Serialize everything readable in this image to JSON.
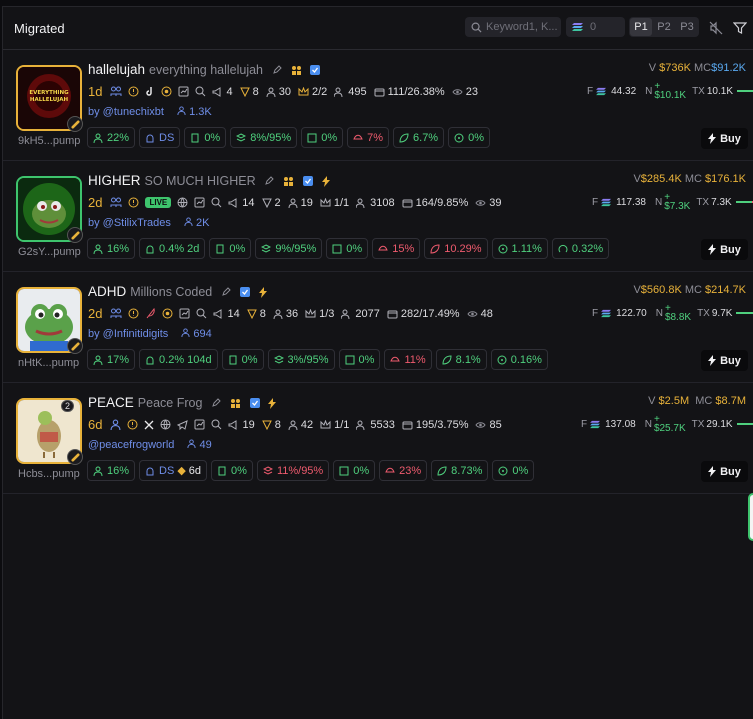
{
  "header": {
    "title": "Migrated",
    "search_placeholder": "Keyword1, K...",
    "min_value": "0",
    "pages": [
      "P1",
      "P2",
      "P3"
    ],
    "active_page": "P1"
  },
  "tokens": [
    {
      "symbol": "hallelujah",
      "name": "everything hallelujah",
      "age": "1d",
      "holders": "4",
      "top10": "8",
      "snipers": "30",
      "dev_holdings": "2/2",
      "holders_count": "495",
      "bundle": "111/26.38%",
      "views": "23",
      "by": "by @tunechixbt",
      "followers": "1.3K",
      "address": "9kH5...pump",
      "volume": "$736K",
      "market_cap": "$91.2K",
      "f_value": "44.32",
      "n_value": "$10.1K",
      "tx": "10.1K",
      "tx_ratio": 0.8,
      "chips": [
        "22%",
        "DS",
        "0%",
        "8%/95%",
        "0%",
        "7%",
        "6.7%",
        "0%"
      ],
      "buy_label": "Buy",
      "avatar_caption": "EVERYTHING HALLELUJAH"
    },
    {
      "symbol": "HIGHER",
      "name": "SO MUCH HIGHER",
      "age": "2d",
      "live_label": "LIVE",
      "holders": "14",
      "top10": "2",
      "snipers": "19",
      "dev_holdings": "1/1",
      "holders_count": "3108",
      "bundle": "164/9.85%",
      "views": "39",
      "by": "by @StilixTrades",
      "followers": "2K",
      "address": "G2sY...pump",
      "volume": "$285.4K",
      "market_cap": "$176.1K",
      "f_value": "117.38",
      "n_value": "$7.3K",
      "tx": "7.3K",
      "tx_ratio": 0.75,
      "chips": [
        "16%",
        "0.4% 2d",
        "0%",
        "9%/95%",
        "0%",
        "15%",
        "10.29%",
        "1.11%",
        "0.32%"
      ],
      "buy_label": "Buy"
    },
    {
      "symbol": "ADHD",
      "name": "Millions Coded",
      "age": "2d",
      "holders": "14",
      "top10": "8",
      "snipers": "36",
      "dev_holdings": "1/3",
      "holders_count": "2077",
      "bundle": "282/17.49%",
      "views": "48",
      "by": "by @Infinitidigits",
      "followers": "694",
      "address": "nHtK...pump",
      "volume": "$560.8K",
      "market_cap": "$214.7K",
      "f_value": "122.70",
      "n_value": "$8.8K",
      "tx": "9.7K",
      "tx_ratio": 0.8,
      "chips": [
        "17%",
        "0.2% 104d",
        "0%",
        "3%/95%",
        "0%",
        "11%",
        "8.1%",
        "0.16%"
      ],
      "buy_label": "Buy"
    },
    {
      "symbol": "PEACE",
      "name": "Peace Frog",
      "age": "6d",
      "avatar_count": "2",
      "holders": "19",
      "top10": "8",
      "snipers": "42",
      "dev_holdings": "1/1",
      "holders_count": "5533",
      "bundle": "195/3.75%",
      "views": "85",
      "by": "@peacefrogworld",
      "followers": "49",
      "address": "Hcbs...pump",
      "volume": "$2.5M",
      "market_cap": "$8.7M",
      "f_value": "137.08",
      "n_value": "$25.7K",
      "tx": "29.1K",
      "tx_ratio": 0.8,
      "chips": [
        "16%",
        "DS",
        "6d",
        "0%",
        "11%/95%",
        "0%",
        "23%",
        "8.73%",
        "0%"
      ],
      "buy_label": "Buy"
    }
  ],
  "labels": {
    "v": "V",
    "mc": "MC",
    "f": "F",
    "n": "N",
    "tx": "TX",
    "plus": "+"
  },
  "colors": {
    "accent_gold": "#e8b23a",
    "green": "#4fd07e",
    "red": "#ef5b6e",
    "blue": "#6f8ee8",
    "cyan": "#5aa9f0"
  }
}
